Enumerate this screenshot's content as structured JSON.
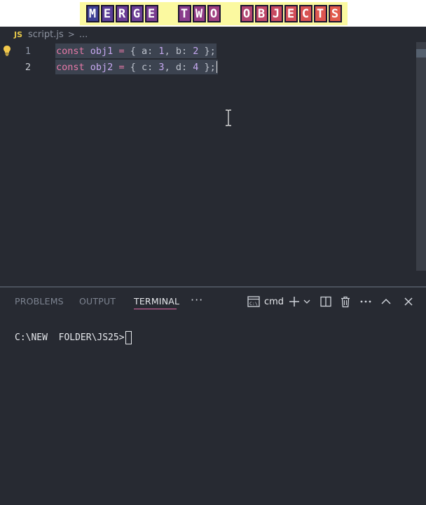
{
  "banner": {
    "words": [
      {
        "letters": [
          {
            "ch": "M",
            "color": "#3d3f94"
          },
          {
            "ch": "E",
            "color": "#5a3d96"
          },
          {
            "ch": "R",
            "color": "#6b3d94"
          },
          {
            "ch": "G",
            "color": "#6b3d94"
          },
          {
            "ch": "E",
            "color": "#7a3d90"
          }
        ]
      },
      {
        "letters": [
          {
            "ch": "T",
            "color": "#8a3d8c"
          },
          {
            "ch": "W",
            "color": "#943d86"
          },
          {
            "ch": "O",
            "color": "#9e3f80"
          }
        ]
      },
      {
        "letters": [
          {
            "ch": "O",
            "color": "#b04470"
          },
          {
            "ch": "B",
            "color": "#bf4868"
          },
          {
            "ch": "J",
            "color": "#c84a60"
          },
          {
            "ch": "E",
            "color": "#d24e58"
          },
          {
            "ch": "C",
            "color": "#d85252"
          },
          {
            "ch": "T",
            "color": "#dd5650"
          },
          {
            "ch": "S",
            "color": "#e25a4c"
          }
        ]
      }
    ]
  },
  "breadcrumb": {
    "icon_label": "JS",
    "file": "script.js",
    "separator": ">",
    "rest": "..."
  },
  "editor": {
    "lines": [
      {
        "number": "1",
        "tokens": {
          "kw": "const",
          "sp1": " ",
          "name": "obj1",
          "sp2": " ",
          "eq": "=",
          "sp3": " ",
          "open": "{",
          "sp4": " ",
          "k1": "a",
          "colon1": ":",
          "sp5": " ",
          "v1": "1",
          "comma": ",",
          "sp6": " ",
          "k2": "b",
          "colon2": ":",
          "sp7": " ",
          "v2": "2",
          "sp8": " ",
          "close": "};"
        }
      },
      {
        "number": "2",
        "tokens": {
          "kw": "const",
          "sp1": " ",
          "name": "obj2",
          "sp2": " ",
          "eq": "=",
          "sp3": " ",
          "open": "{",
          "sp4": " ",
          "k1": "c",
          "colon1": ":",
          "sp5": " ",
          "v1": "3",
          "comma": ",",
          "sp6": " ",
          "k2": "d",
          "colon2": ":",
          "sp7": " ",
          "v2": "4",
          "sp8": " ",
          "close": "};"
        }
      }
    ]
  },
  "panel": {
    "tabs": {
      "problems": "PROBLEMS",
      "output": "OUTPUT",
      "terminal": "TERMINAL",
      "more": "···"
    },
    "toolbar": {
      "shell_label": "cmd",
      "icons": [
        "terminal-shell-icon",
        "plus-icon",
        "chevron-down-icon",
        "split-icon",
        "trash-icon",
        "more-icon",
        "chevron-up-icon",
        "close-icon"
      ]
    },
    "terminal": {
      "prompt": "C:\\NEW  FOLDER\\JS25>"
    }
  },
  "colors": {
    "accent": "#e16aa7",
    "keyword": "#e879a8",
    "identifier": "#c6a8f0",
    "selection": "#3c4350",
    "background": "#272a32"
  }
}
